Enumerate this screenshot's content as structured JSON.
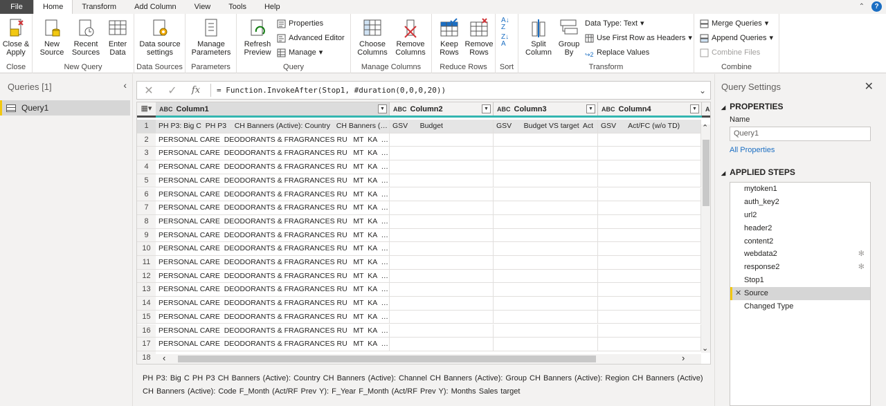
{
  "tabs": [
    "File",
    "Home",
    "Transform",
    "Add Column",
    "View",
    "Tools",
    "Help"
  ],
  "ribbon": {
    "close": {
      "btn": "Close &\nApply",
      "label": "Close"
    },
    "new_query": {
      "new_source": "New\nSource",
      "recent_sources": "Recent\nSources",
      "enter_data": "Enter\nData",
      "label": "New Query"
    },
    "data_sources": {
      "btn": "Data source\nsettings",
      "label": "Data Sources"
    },
    "parameters": {
      "btn": "Manage\nParameters",
      "label": "Parameters"
    },
    "query": {
      "refresh": "Refresh\nPreview",
      "properties": "Properties",
      "advanced_editor": "Advanced Editor",
      "manage": "Manage",
      "label": "Query"
    },
    "manage_columns": {
      "choose": "Choose\nColumns",
      "remove": "Remove\nColumns",
      "label": "Manage Columns"
    },
    "reduce_rows": {
      "keep": "Keep\nRows",
      "remove": "Remove\nRows",
      "label": "Reduce Rows"
    },
    "sort": {
      "label": "Sort"
    },
    "transform": {
      "split": "Split\nColumn",
      "group_by": "Group\nBy",
      "data_type": "Data Type: Text",
      "first_row": "Use First Row as Headers",
      "replace": "Replace Values",
      "label": "Transform"
    },
    "combine": {
      "merge": "Merge Queries",
      "append": "Append Queries",
      "combine_files": "Combine Files",
      "label": "Combine"
    }
  },
  "queries_pane": {
    "title": "Queries [1]",
    "items": [
      "Query1"
    ]
  },
  "formula": "= Function.InvokeAfter(Stop1, #duration(0,0,0,20))",
  "grid": {
    "type_icon": "ABC",
    "columns": [
      "Column1",
      "Column2",
      "Column3",
      "Column4"
    ],
    "next_column_type": "ABC",
    "row1": [
      "PH P3: Big C  PH P3    CH Banners (Active): Country   CH Banners (Acti...",
      "GSV      Budget",
      "GSV      Budget VS target  Act",
      "GSV      Act/FC (w/o TD)"
    ],
    "repeat_cell": "PERSONAL CARE  DEODORANTS & FRAGRANCES RU   MT  KA   KA_TOP...",
    "row_numbers": [
      "1",
      "2",
      "3",
      "4",
      "5",
      "6",
      "7",
      "8",
      "9",
      "10",
      "11",
      "12",
      "13",
      "14",
      "15",
      "16",
      "17",
      "18"
    ]
  },
  "preview_text": "PH P3: Big C   PH P3     CH Banners (Active): Country   CH Banners (Active): Channel   CH Banners (Active): Group     CH Banners (Active): Region     CH Banners (Active)  CH Banners (Active): Code F_Month (Act/RF Prev Y): F_Year    F_Month (Act/RF Prev Y): Months   Sales target",
  "settings": {
    "title": "Query Settings",
    "properties": "PROPERTIES",
    "name_label": "Name",
    "name_value": "Query1",
    "all_properties": "All Properties",
    "applied_steps": "APPLIED STEPS",
    "steps": [
      "mytoken1",
      "auth_key2",
      "url2",
      "header2",
      "content2",
      "webdata2",
      "response2",
      "Stop1",
      "Source",
      "Changed Type"
    ]
  },
  "colors": {
    "accent": "#f2c811",
    "quality": "#33b6b0",
    "file_tab": "#4a4a4a",
    "link": "#1b6ec2"
  }
}
